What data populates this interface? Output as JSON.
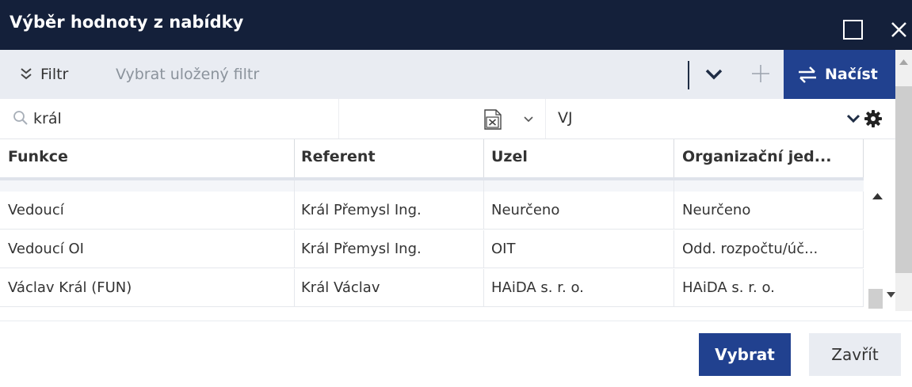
{
  "dialog": {
    "title": "Výběr hodnoty z nabídky"
  },
  "filterbar": {
    "filter_label": "Filtr",
    "saved_filter_placeholder": "Vybrat uložený filtr",
    "load_label": "Načíst"
  },
  "toolbar": {
    "search_value": "král",
    "unit_value": "VJ"
  },
  "grid": {
    "columns": [
      "Funkce",
      "Referent",
      "Uzel",
      "Organizační jed..."
    ],
    "rows": [
      [
        "Vedoucí",
        "Král Přemysl Ing.",
        "Neurčeno",
        "Neurčeno"
      ],
      [
        "Vedoucí OI",
        "Král Přemysl Ing.",
        "OIT",
        "Odd. rozpočtu/úč..."
      ],
      [
        "Václav Král (FUN)",
        "Král Václav",
        "HAiDA s. r. o.",
        "HAiDA s. r. o."
      ]
    ]
  },
  "footer": {
    "select_label": "Vybrat",
    "close_label": "Zavřít"
  },
  "colors": {
    "titlebar": "#14203a",
    "primary": "#21418f",
    "toolbar_bg": "#e9ecf2"
  },
  "icons": [
    "maximize-icon",
    "close-icon",
    "double-chevron-down-icon",
    "chevron-down-icon",
    "plus-icon",
    "refresh-icon",
    "search-icon",
    "excel-export-icon",
    "gear-icon",
    "scroll-up-icon",
    "scroll-down-icon"
  ]
}
